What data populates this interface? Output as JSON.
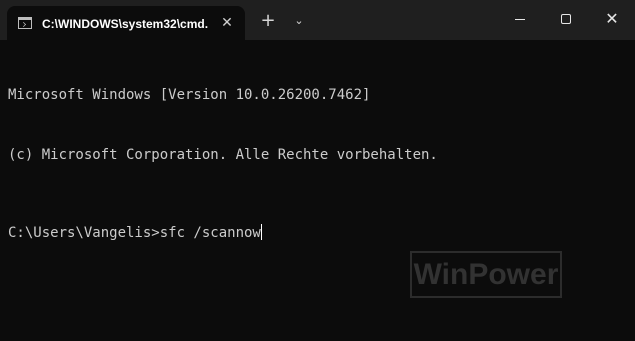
{
  "window": {
    "tab_title": "C:\\WINDOWS\\system32\\cmd.",
    "tab_close_glyph": "✕",
    "new_tab_glyph": "+",
    "dropdown_glyph": "⌄",
    "close_glyph": "✕"
  },
  "terminal": {
    "lines": [
      "Microsoft Windows [Version 10.0.26200.7462]",
      "(c) Microsoft Corporation. Alle Rechte vorbehalten."
    ],
    "prompt": "C:\\Users\\Vangelis>",
    "command": "sfc /scannow"
  },
  "watermark": {
    "text": "WinPower"
  },
  "colors": {
    "background": "#0c0c0c",
    "titlebar": "#1f1f1f",
    "foreground": "#cccccc"
  },
  "icons": {
    "tab": "cmd-icon",
    "tab_close": "close-icon",
    "new_tab": "plus-icon",
    "dropdown": "chevron-down-icon",
    "minimize": "minimize-icon",
    "maximize": "maximize-icon",
    "close": "close-icon"
  }
}
